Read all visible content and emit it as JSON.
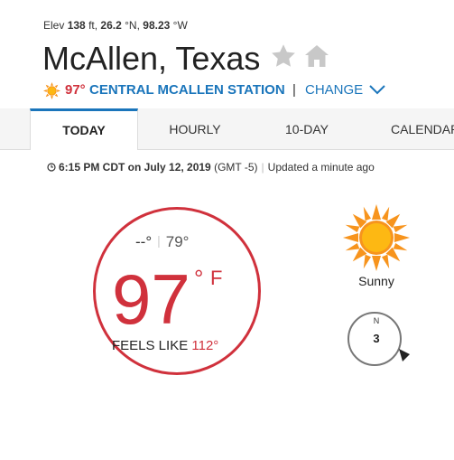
{
  "location": {
    "elev_prefix": "Elev",
    "elev_value": "138",
    "elev_unit": "ft,",
    "lat_value": "26.2",
    "lat_unit": "°N,",
    "lon_value": "98.23",
    "lon_unit": "°W",
    "city": "McAllen, Texas"
  },
  "station": {
    "temp": "97°",
    "name": "CENTRAL MCALLEN STATION",
    "separator": "|",
    "change_label": "CHANGE"
  },
  "tabs": [
    {
      "label": "TODAY",
      "active": true
    },
    {
      "label": "HOURLY",
      "active": false
    },
    {
      "label": "10-DAY",
      "active": false
    },
    {
      "label": "CALENDAR",
      "active": false
    }
  ],
  "updated": {
    "time": "6:15 PM CDT on July 12, 2019",
    "gmt": "(GMT -5)",
    "separator": "|",
    "text": "Updated a minute ago"
  },
  "current": {
    "high": "--°",
    "low": "79°",
    "separator": "|",
    "temp": "97",
    "degree": "°",
    "unit": "F",
    "feels_label": "FEELS LIKE",
    "feels_value": "112°",
    "condition": "Sunny",
    "condition_icon": "sun-icon",
    "wind_dir": "N",
    "wind_speed": "3"
  },
  "colors": {
    "accent_red": "#d0313c",
    "link_blue": "#1a75bb",
    "sun_orange": "#f7941d",
    "sun_yellow": "#fdb813"
  }
}
